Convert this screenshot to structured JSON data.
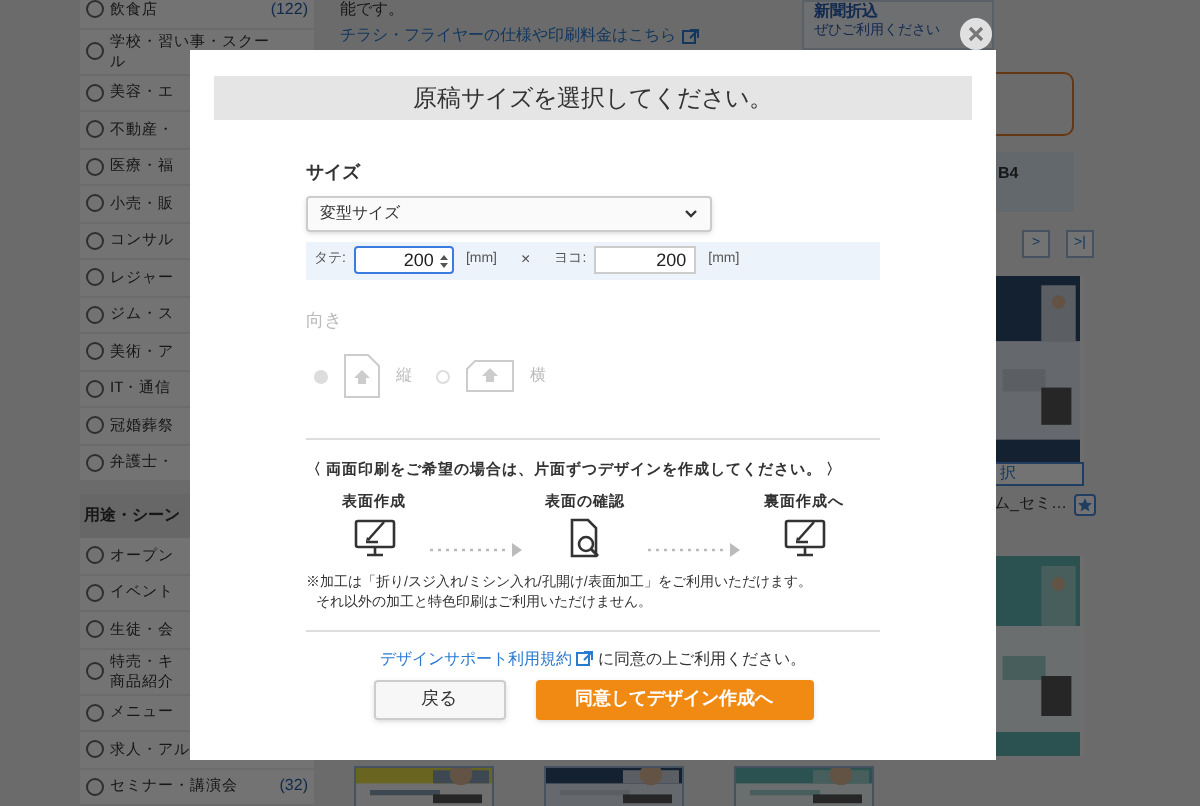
{
  "background": {
    "sidebar": {
      "categories": [
        {
          "label": "飲食店",
          "count": "(122)",
          "selected": false
        },
        {
          "label": "学校・習い事・スクー",
          "label_line_2": "ル",
          "selected": false
        },
        {
          "label": "美容・エ",
          "selected": false
        },
        {
          "label": "不動産・",
          "selected": false
        },
        {
          "label": "医療・福",
          "selected": false
        },
        {
          "label": "小売・販",
          "selected": false
        },
        {
          "label": "コンサル",
          "selected": false
        },
        {
          "label": "レジャー",
          "selected": false
        },
        {
          "label": "ジム・ス",
          "selected": false
        },
        {
          "label": "美術・ア",
          "selected": false
        },
        {
          "label": "IT・通信",
          "selected": false
        },
        {
          "label": "冠婚葬祭",
          "selected": false
        },
        {
          "label": "弁護士・",
          "selected": false
        }
      ],
      "scene_header": "用途・シーン",
      "scenes": [
        {
          "label": "オープン",
          "selected": false
        },
        {
          "label": "イベント",
          "selected": false
        },
        {
          "label": "生徒・会",
          "selected": false
        },
        {
          "label": "特売・キ",
          "label_line_2": "商品紹介",
          "selected": false
        },
        {
          "label": "メニュー",
          "selected": false
        },
        {
          "label": "求人・アル",
          "selected": false
        },
        {
          "label": "セミナー・講演会",
          "count": "(32)",
          "selected": false
        }
      ]
    },
    "intro_text": "能です。",
    "spec_link": "チラシ・フライヤーの仕様や印刷料金はこちら",
    "promo": {
      "title": "新聞折込",
      "link": "ぜひご利用ください"
    },
    "size_label": "B4",
    "pagination": [
      ">",
      ">|"
    ],
    "select_button": "択",
    "template_name": "ム_セミ…"
  },
  "modal": {
    "title": "原稿サイズを選択してください。",
    "size_heading": "サイズ",
    "size_select": {
      "value": "変型サイズ"
    },
    "height": {
      "label": "タテ:",
      "value": "200",
      "unit": "[mm]"
    },
    "times": "×",
    "width": {
      "label": "ヨコ:",
      "value": "200",
      "unit": "[mm]"
    },
    "orientation": {
      "heading": "向き",
      "disabled": true,
      "options": [
        {
          "label": "縦",
          "kind": "portrait",
          "selected": true
        },
        {
          "label": "横",
          "kind": "landscape",
          "selected": false
        }
      ]
    },
    "duplex_note": "〈 両面印刷をご希望の場合は、片面ずつデザインを作成してください。 〉",
    "steps": [
      {
        "label": "表面作成",
        "kind": "edit"
      },
      {
        "label": "表面の確認",
        "kind": "inspect"
      },
      {
        "label": "裏面作成へ",
        "kind": "edit"
      }
    ],
    "notes": [
      "※加工は「折り/スジ入れ/ミシン入れ/孔開け/表面加工」をご利用いただけます。",
      "それ以外の加工と特色印刷はご利用いただけません。"
    ],
    "terms": {
      "link": "デザインサポート利用規約",
      "text": "に同意の上ご利用ください。"
    },
    "buttons": [
      {
        "label": "戻る",
        "kind": "secondary"
      },
      {
        "label": "同意してデザイン作成へ",
        "kind": "primary"
      }
    ]
  }
}
